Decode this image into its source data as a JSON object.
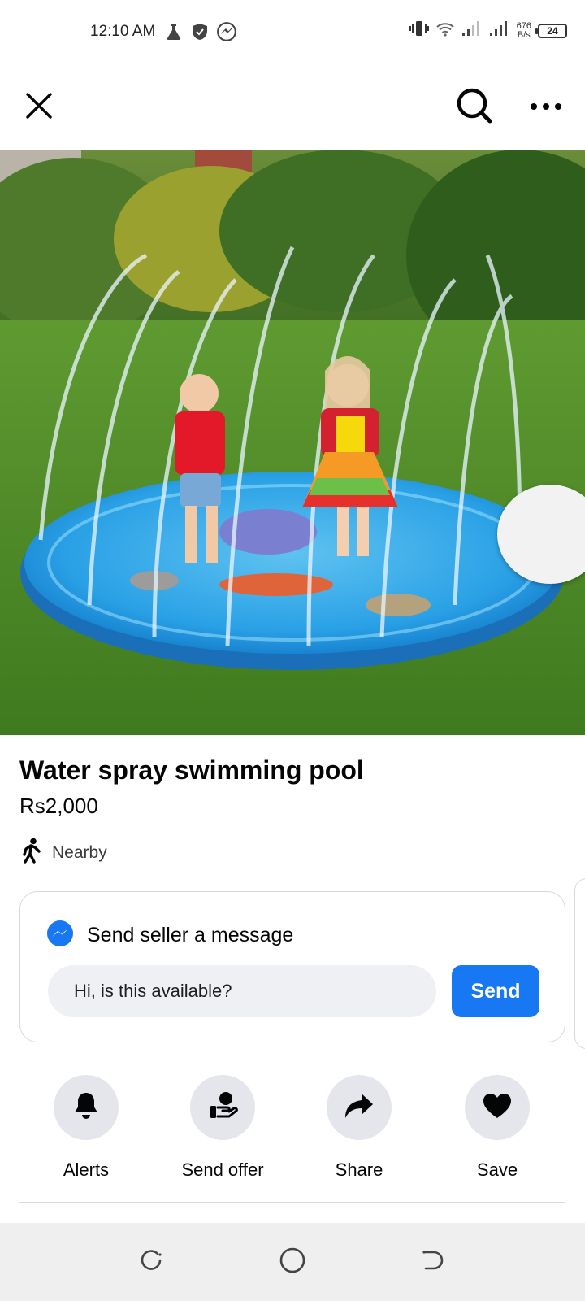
{
  "status_bar": {
    "time": "12:10 AM",
    "net_speed_value": "676",
    "net_speed_unit": "B/s",
    "battery": "24",
    "icons": [
      "flask-icon",
      "shield-icon",
      "messenger-icon",
      "vibrate-icon",
      "wifi-icon",
      "signal-icon",
      "signal-icon"
    ]
  },
  "top_bar": {
    "icons": [
      "close-icon",
      "search-icon",
      "more-icon"
    ]
  },
  "listing": {
    "title": "Water spray swimming pool",
    "price": "Rs2,000",
    "location": "Nearby",
    "location_icon": "walking-person-icon"
  },
  "message": {
    "header": "Send seller a message",
    "header_icon": "messenger-icon",
    "input_value": "Hi, is this available?",
    "send_label": "Send",
    "accent": "#1877f2"
  },
  "actions": [
    {
      "label": "Alerts",
      "icon": "bell-icon"
    },
    {
      "label": "Send offer",
      "icon": "offer-icon"
    },
    {
      "label": "Share",
      "icon": "share-icon"
    },
    {
      "label": "Save",
      "icon": "heart-icon"
    }
  ],
  "nav_bar": {
    "icons": [
      "recent-apps-icon",
      "home-icon",
      "back-icon"
    ]
  }
}
